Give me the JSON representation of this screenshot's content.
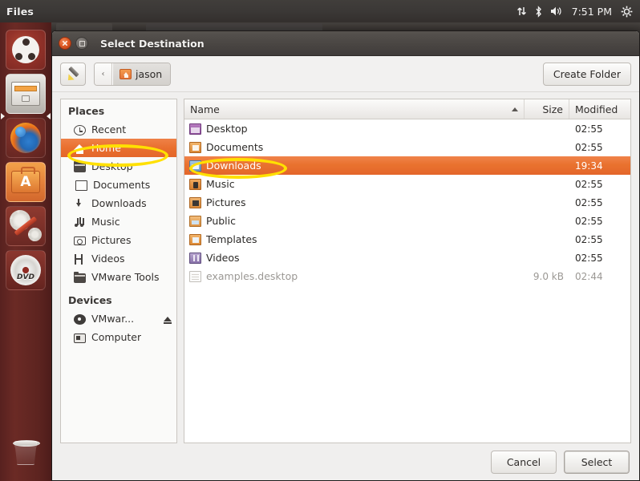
{
  "top_panel": {
    "app_title": "Files",
    "tray": {
      "network_icon": "network-updown-icon",
      "bluetooth_icon": "bluetooth-icon",
      "volume_icon": "volume-icon",
      "clock": "7:51 PM",
      "settings_icon": "gear-icon"
    }
  },
  "launcher": {
    "items": [
      {
        "name": "ubuntu-dash",
        "icon": "ubuntu-logo-icon"
      },
      {
        "name": "files",
        "icon": "file-manager-icon",
        "active": true
      },
      {
        "name": "firefox",
        "icon": "firefox-icon"
      },
      {
        "name": "ubuntu-software",
        "icon": "software-center-icon"
      },
      {
        "name": "system-settings",
        "icon": "gears-wrench-icon"
      },
      {
        "name": "dvd-drive",
        "icon": "dvd-disc-icon"
      }
    ],
    "trash": {
      "name": "trash",
      "icon": "trash-bin-icon"
    }
  },
  "dialog": {
    "title": "Select Destination",
    "close_label": "×",
    "toolbar": {
      "location_button_icon": "pencil-icon",
      "back_chevron": "‹",
      "breadcrumb": [
        {
          "label": "jason",
          "icon": "home-folder-icon",
          "active": true
        }
      ],
      "create_folder_label": "Create Folder"
    },
    "sidebar": {
      "sections": [
        {
          "heading": "Places",
          "items": [
            {
              "label": "Recent",
              "icon": "clock-icon",
              "selected": false
            },
            {
              "label": "Home",
              "icon": "home-icon",
              "selected": true
            },
            {
              "label": "Desktop",
              "icon": "folder-icon",
              "selected": false
            },
            {
              "label": "Documents",
              "icon": "document-icon",
              "selected": false
            },
            {
              "label": "Downloads",
              "icon": "download-arrow-icon",
              "selected": false
            },
            {
              "label": "Music",
              "icon": "music-note-icon",
              "selected": false
            },
            {
              "label": "Pictures",
              "icon": "camera-icon",
              "selected": false
            },
            {
              "label": "Videos",
              "icon": "film-icon",
              "selected": false
            },
            {
              "label": "VMware Tools",
              "icon": "folder-icon",
              "selected": false
            }
          ]
        },
        {
          "heading": "Devices",
          "items": [
            {
              "label": "VMwar...",
              "icon": "disc-icon",
              "selected": false,
              "eject": true
            },
            {
              "label": "Computer",
              "icon": "computer-icon",
              "selected": false
            }
          ]
        }
      ]
    },
    "file_list": {
      "columns": {
        "name": "Name",
        "size": "Size",
        "modified": "Modified"
      },
      "sort_column": "Name",
      "sort_direction": "ascending",
      "rows": [
        {
          "name": "Desktop",
          "size": "",
          "modified": "02:55",
          "icon": "folder-desktop-icon",
          "selected": false,
          "dim": false
        },
        {
          "name": "Documents",
          "size": "",
          "modified": "02:55",
          "icon": "folder-documents-icon",
          "selected": false,
          "dim": false
        },
        {
          "name": "Downloads",
          "size": "",
          "modified": "19:34",
          "icon": "folder-downloads-icon",
          "selected": true,
          "dim": false
        },
        {
          "name": "Music",
          "size": "",
          "modified": "02:55",
          "icon": "folder-music-icon",
          "selected": false,
          "dim": false
        },
        {
          "name": "Pictures",
          "size": "",
          "modified": "02:55",
          "icon": "folder-pictures-icon",
          "selected": false,
          "dim": false
        },
        {
          "name": "Public",
          "size": "",
          "modified": "02:55",
          "icon": "folder-public-icon",
          "selected": false,
          "dim": false
        },
        {
          "name": "Templates",
          "size": "",
          "modified": "02:55",
          "icon": "folder-templates-icon",
          "selected": false,
          "dim": false
        },
        {
          "name": "Videos",
          "size": "",
          "modified": "02:55",
          "icon": "folder-videos-icon",
          "selected": false,
          "dim": false
        },
        {
          "name": "examples.desktop",
          "size": "9.0 kB",
          "modified": "02:44",
          "icon": "text-file-icon",
          "selected": false,
          "dim": true
        }
      ]
    },
    "footer": {
      "cancel_label": "Cancel",
      "select_label": "Select"
    }
  },
  "annotations": [
    {
      "name": "highlight-home",
      "shape": "ellipse",
      "color": "#ffe000",
      "target": "Home"
    },
    {
      "name": "highlight-downloads",
      "shape": "ellipse",
      "color": "#ffe000",
      "target": "Downloads"
    }
  ]
}
